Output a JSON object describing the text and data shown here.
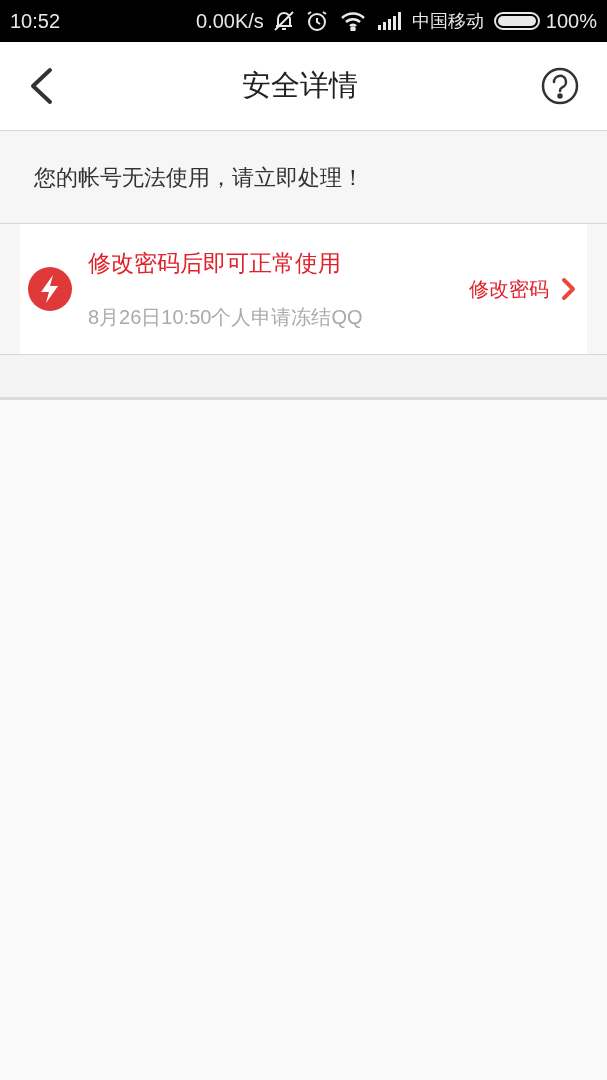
{
  "status_bar": {
    "time": "10:52",
    "speed": "0.00K/s",
    "carrier": "中国移动",
    "battery": "100%"
  },
  "header": {
    "title": "安全详情"
  },
  "notice": "您的帐号无法使用，请立即处理！",
  "alerts": [
    {
      "title": "修改密码后即可正常使用",
      "detail": "8月26日10:50个人申请冻结QQ",
      "action": "修改密码"
    }
  ]
}
